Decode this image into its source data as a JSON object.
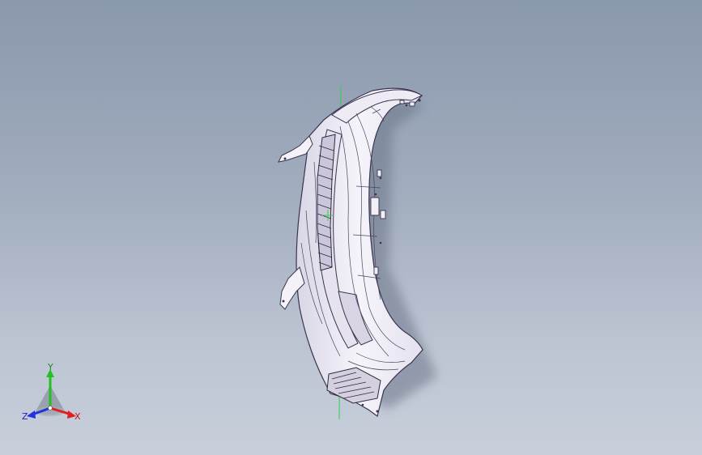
{
  "viewport": {
    "background_top": "#8a98ad",
    "background_bottom": "#c8cfdb"
  },
  "model": {
    "fill": "#f2f0f6",
    "edge": "#3a3550",
    "shadow": "#6c7688",
    "origin_axis_color": "#2fd14a"
  },
  "triad": {
    "x_label": "X",
    "y_label": "Y",
    "z_label": "Z",
    "x_color": "#e02020",
    "y_color": "#22c022",
    "z_color": "#2233dd"
  }
}
